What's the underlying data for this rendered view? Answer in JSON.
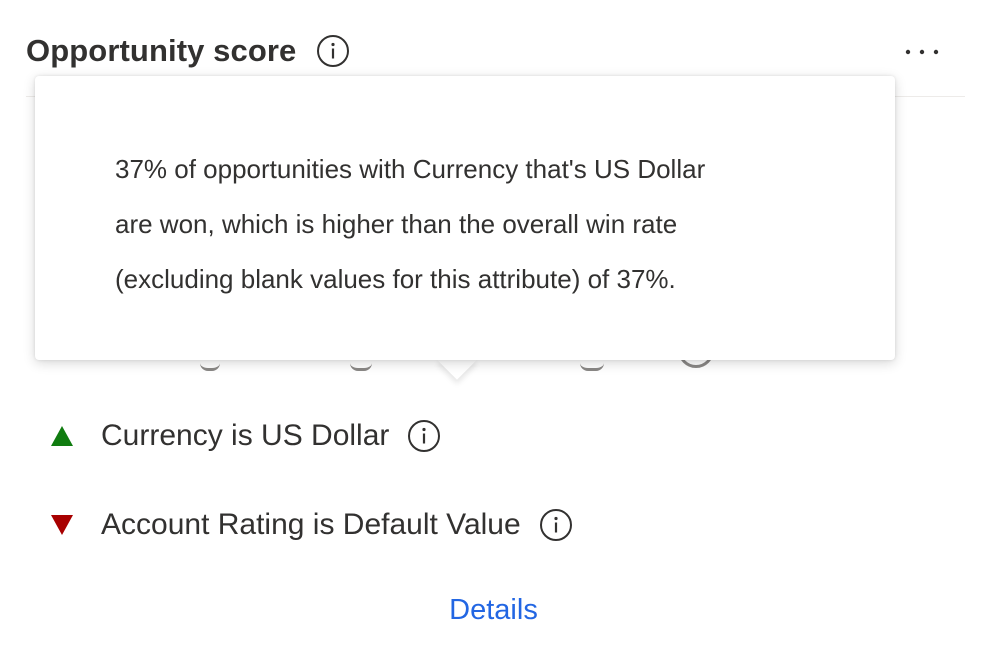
{
  "header": {
    "title": "Opportunity score",
    "info_icon": "info-circle-icon",
    "more_icon": "more-horizontal-icon"
  },
  "tooltip": {
    "lines": [
      "37% of opportunities with Currency that's US Dollar",
      "are won, which is higher than the overall win rate",
      "(excluding blank values for this attribute) of 37%."
    ]
  },
  "factors": [
    {
      "label": "Currency is US Dollar",
      "direction": "up",
      "color": "#107c10",
      "icon": "triangle-up-icon"
    },
    {
      "label": "Account Rating is Default Value",
      "direction": "down",
      "color": "#a80000",
      "icon": "triangle-down-icon"
    }
  ],
  "details_link": "Details",
  "colors": {
    "text": "#323130",
    "link": "#2266e3",
    "positive": "#107c10",
    "negative": "#a80000"
  }
}
